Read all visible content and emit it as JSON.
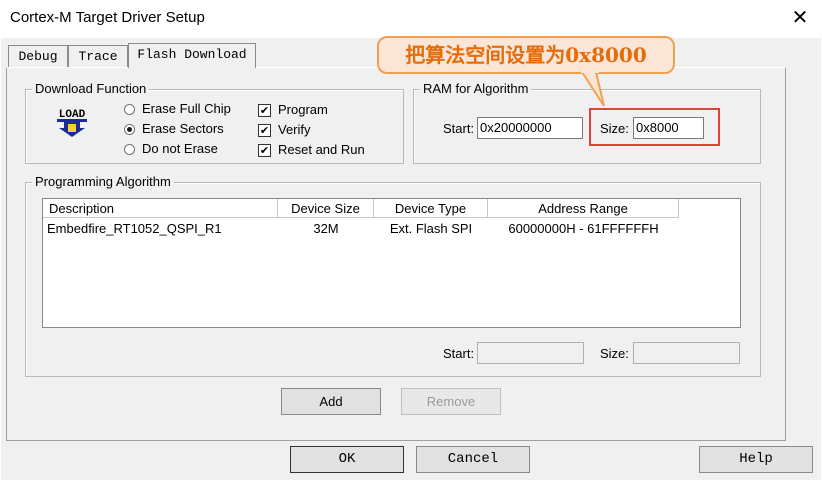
{
  "window": {
    "title": "Cortex-M Target Driver Setup",
    "close_glyph": "✕"
  },
  "tabs": [
    {
      "label": "Debug",
      "active": false
    },
    {
      "label": "Trace",
      "active": false
    },
    {
      "label": "Flash Download",
      "active": true
    }
  ],
  "download_function": {
    "legend": "Download Function",
    "icon": "load-icon",
    "icon_text": "LOAD",
    "radios": [
      {
        "label": "Erase Full Chip",
        "selected": false
      },
      {
        "label": "Erase Sectors",
        "selected": true
      },
      {
        "label": "Do not Erase",
        "selected": false
      }
    ],
    "checks": [
      {
        "label": "Program",
        "checked": true
      },
      {
        "label": "Verify",
        "checked": true
      },
      {
        "label": "Reset and Run",
        "checked": true
      }
    ]
  },
  "ram_for_algorithm": {
    "legend": "RAM for Algorithm",
    "start_label": "Start:",
    "start_value": "0x20000000",
    "size_label": "Size:",
    "size_value": "0x8000"
  },
  "annotation": {
    "text": "把算法空间设置为0x8000",
    "color": "#e46c0a",
    "box_color": "#e1403b"
  },
  "programming_algorithm": {
    "legend": "Programming Algorithm",
    "columns": [
      "Description",
      "Device Size",
      "Device Type",
      "Address Range"
    ],
    "rows": [
      [
        "Embedfire_RT1052_QSPI_R1",
        "32M",
        "Ext. Flash SPI",
        "60000000H - 61FFFFFFH"
      ]
    ],
    "start_label": "Start:",
    "start_value": "",
    "size_label": "Size:",
    "size_value": ""
  },
  "buttons": {
    "add": "Add",
    "remove": "Remove",
    "ok": "OK",
    "cancel": "Cancel",
    "help": "Help"
  }
}
